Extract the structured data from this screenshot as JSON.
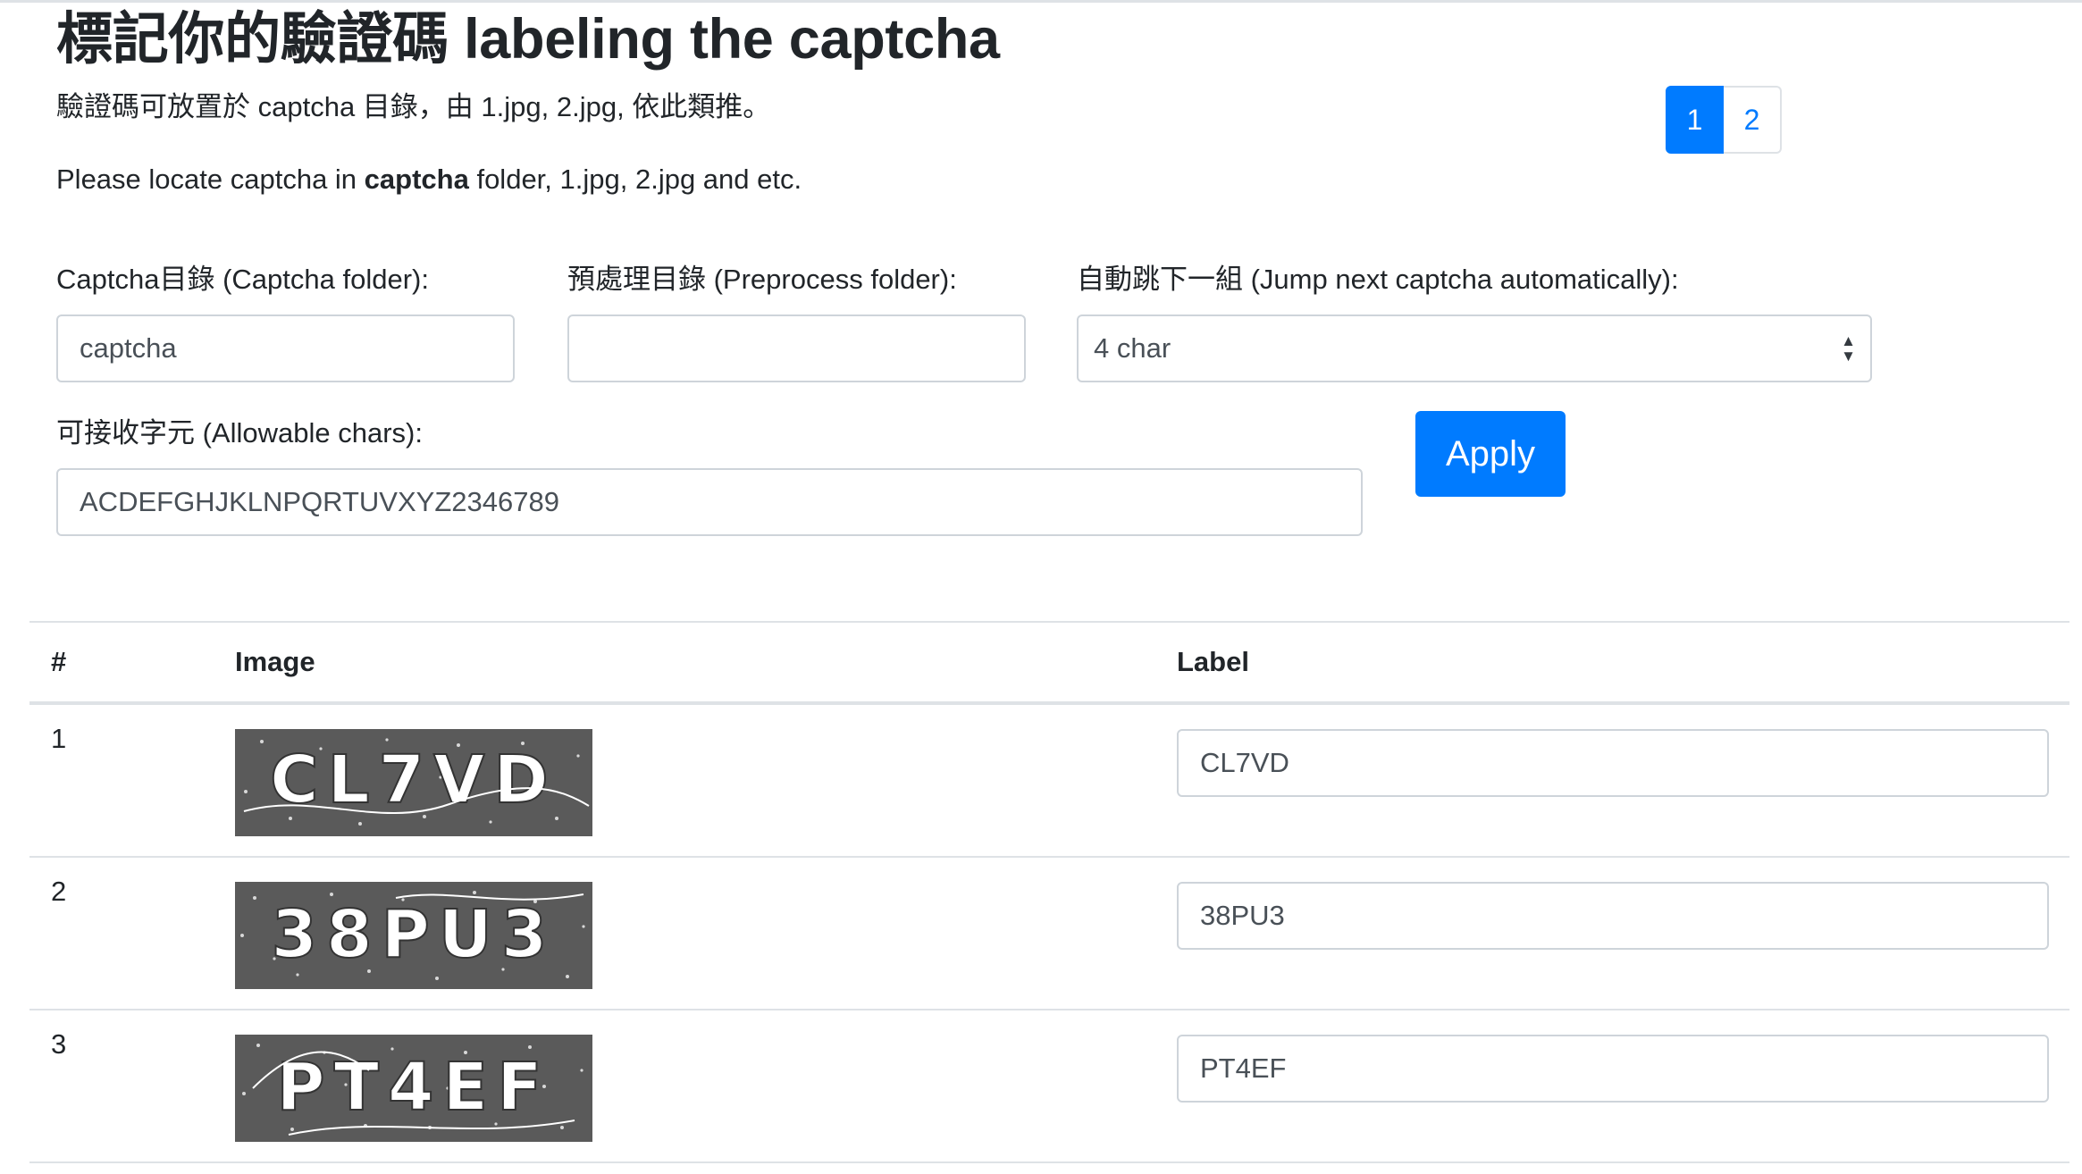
{
  "page": {
    "title": "標記你的驗證碼 labeling the captcha",
    "desc_zh": "驗證碼可放置於 captcha 目錄，由 1.jpg, 2.jpg, 依此類推。",
    "desc_en_pre": "Please locate captcha in ",
    "desc_en_bold": "captcha",
    "desc_en_post": " folder, 1.jpg, 2.jpg and etc."
  },
  "pagination": {
    "pages": [
      "1",
      "2"
    ],
    "active": "1"
  },
  "form": {
    "captcha_folder_label": "Captcha目錄 (Captcha folder):",
    "captcha_folder_value": "captcha",
    "preprocess_folder_label": "預處理目錄 (Preprocess folder):",
    "preprocess_folder_value": "",
    "jump_label": "自動跳下一組 (Jump next captcha automatically):",
    "jump_selected": "4 char",
    "chars_label": "可接收字元 (Allowable chars):",
    "chars_value": "ACDEFGHJKLNPQRTUVXYZ2346789",
    "apply_label": "Apply"
  },
  "table": {
    "headers": [
      "#",
      "Image",
      "Label"
    ],
    "rows": [
      {
        "num": "1",
        "captcha_text": "CL7VD",
        "label": "CL7VD"
      },
      {
        "num": "2",
        "captcha_text": "38PU3",
        "label": "38PU3"
      },
      {
        "num": "3",
        "captcha_text": "PT4EF",
        "label": "PT4EF"
      }
    ]
  },
  "colors": {
    "primary": "#007bff",
    "border": "#dee2e6",
    "input_border": "#ced4da",
    "captcha_bg": "#5a5a5a"
  }
}
